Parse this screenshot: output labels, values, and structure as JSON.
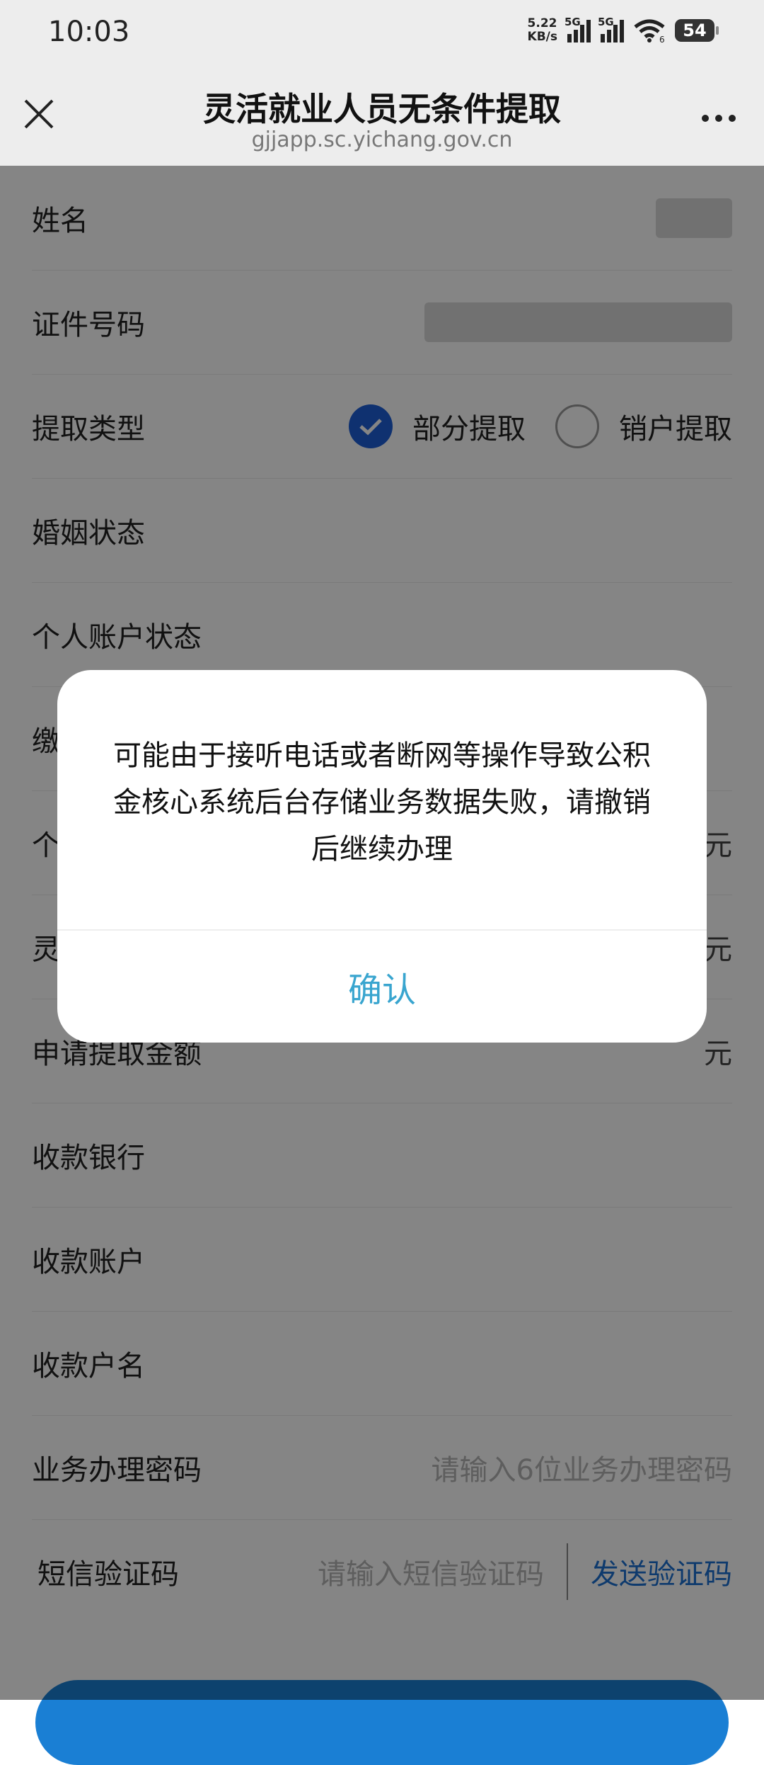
{
  "status_bar": {
    "time": "10:03",
    "net_speed_value": "5.22",
    "net_speed_unit": "KB/s",
    "network_1": "5G",
    "network_2": "5G",
    "wifi_label": "6",
    "battery": "54"
  },
  "nav": {
    "title": "灵活就业人员无条件提取",
    "url": "gjjapp.sc.yichang.gov.cn"
  },
  "form": {
    "name_label": "姓名",
    "id_label": "证件号码",
    "withdraw_type_label": "提取类型",
    "option_partial": "部分提取",
    "option_close": "销户提取",
    "marital_label": "婚姻状态",
    "account_status_label": "个人账户状态",
    "row6_prefix": "缴",
    "row7_prefix": "个",
    "row7_unit": "元",
    "row8_prefix": "灵",
    "row8_unit": "元",
    "apply_amount_label": "申请提取金额",
    "apply_amount_unit": "元",
    "bank_label": "收款银行",
    "account_label": "收款账户",
    "account_name_label": "收款户名",
    "password_label": "业务办理密码",
    "password_placeholder": "请输入6位业务办理密码",
    "sms_label": "短信验证码",
    "sms_placeholder": "请输入短信验证码",
    "sms_send": "发送验证码"
  },
  "dialog": {
    "message": "可能由于接听电话或者断网等操作导致公积金核心系统后台存储业务数据失败，请撤销后继续办理",
    "confirm": "确认"
  },
  "colors": {
    "accent": "#1d5fd6",
    "dialog_button": "#39a5cf",
    "link": "#1c6fd1"
  }
}
